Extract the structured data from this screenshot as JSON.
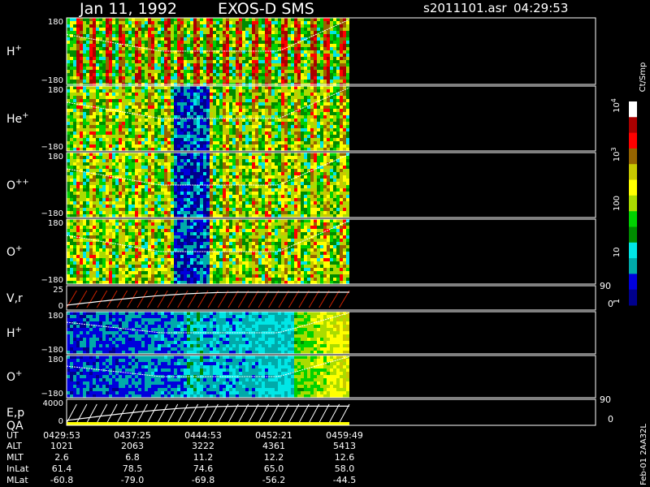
{
  "header": {
    "date": "Jan 11, 1992",
    "instrument": "EXOS-D SMS",
    "file": "s2011101.asr",
    "time": "04:29:53"
  },
  "colors": {
    "background": "#000000",
    "frame": "#ffffff",
    "trace": "#ffffff",
    "colorscale": [
      "#00008c",
      "#0000dc",
      "#00aaaa",
      "#00e6e6",
      "#008c00",
      "#00d200",
      "#aadc00",
      "#ffff00",
      "#c8c800",
      "#966400",
      "#ff0000",
      "#aa0000",
      "#ffffff"
    ]
  },
  "chart_data": {
    "type": "heatmap",
    "panels": [
      {
        "name": "H+",
        "label": "H",
        "sup": "+",
        "kind": "spectrogram",
        "ymax": "180",
        "ymin": "-180",
        "ylim": [
          -180,
          180
        ]
      },
      {
        "name": "He+",
        "label": "He",
        "sup": "+",
        "kind": "spectrogram",
        "ymax": "180",
        "ymin": "-180",
        "ylim": [
          -180,
          180
        ]
      },
      {
        "name": "O++",
        "label": "O",
        "sup": "++",
        "kind": "spectrogram",
        "ymax": "180",
        "ymin": "-180",
        "ylim": [
          -180,
          180
        ]
      },
      {
        "name": "O+",
        "label": "O",
        "sup": "+",
        "kind": "spectrogram",
        "ymax": "180",
        "ymin": "-180",
        "ylim": [
          -180,
          180
        ]
      },
      {
        "name": "V,r",
        "label": "V,r",
        "sup": "",
        "kind": "line",
        "ymax": "25",
        "ymin": "0",
        "ylim": [
          0,
          25
        ],
        "right_top": "90",
        "right_bottom": "0"
      },
      {
        "name": "H+ (2)",
        "label": "H",
        "sup": "+",
        "kind": "spectrogram",
        "ymax": "180",
        "ymin": "-180",
        "ylim": [
          -180,
          180
        ]
      },
      {
        "name": "O+ (2)",
        "label": "O",
        "sup": "+",
        "kind": "spectrogram",
        "ymax": "180",
        "ymin": "-180",
        "ylim": [
          -180,
          180
        ]
      },
      {
        "name": "E,p QA",
        "label": "E,p",
        "label2": "QA",
        "sup": "",
        "kind": "line",
        "ymax": "4000",
        "ymin": "0",
        "ylim": [
          0,
          4000
        ],
        "right_top": "90",
        "right_bottom": "0"
      }
    ],
    "colorbar": {
      "label": "Ct/Smp",
      "ticks": [
        {
          "base": "10",
          "exp": "4",
          "value": 10000
        },
        {
          "base": "10",
          "exp": "3",
          "value": 1000
        },
        {
          "base": "100",
          "exp": "",
          "value": 100
        },
        {
          "base": "10",
          "exp": "",
          "value": 10
        },
        {
          "base": "1",
          "exp": "",
          "value": 1
        }
      ],
      "scale": "log"
    },
    "x_labels": [
      "UT",
      "ALT",
      "MLT",
      "InLat",
      "MLat"
    ],
    "x_ticks": [
      {
        "UT": "0429:53",
        "ALT": "1021",
        "MLT": "2.6",
        "InLat": "61.4",
        "MLat": "-60.8"
      },
      {
        "UT": "0437:25",
        "ALT": "2063",
        "MLT": "6.8",
        "InLat": "78.5",
        "MLat": "-79.0"
      },
      {
        "UT": "0444:53",
        "ALT": "3222",
        "MLT": "11.2",
        "InLat": "74.6",
        "MLat": "-69.8"
      },
      {
        "UT": "0452:21",
        "ALT": "4361",
        "MLT": "12.2",
        "InLat": "65.0",
        "MLat": "-56.2"
      },
      {
        "UT": "0459:49",
        "ALT": "5413",
        "MLT": "12.6",
        "InLat": "58.0",
        "MLat": "-44.5"
      }
    ],
    "footer": "Feb-01  2AA32L"
  }
}
